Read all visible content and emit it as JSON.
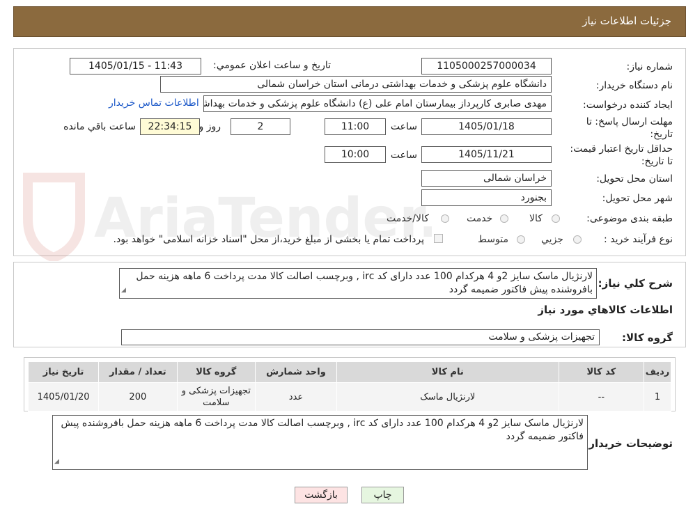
{
  "header": {
    "title": "جزئیات اطلاعات نیاز"
  },
  "watermark_text": "AriaTender.neT",
  "form": {
    "need_number_label": "شماره نیاز:",
    "need_number": "1105000257000034",
    "announce_label": "تاریخ و ساعت اعلان عمومي:",
    "announce_value": "1405/01/15 - 11:43",
    "buyer_org_label": "نام دستگاه خريدار:",
    "buyer_org": "دانشگاه علوم پزشکی و خدمات بهداشتی درمانی استان خراسان شمالی",
    "creator_label": "ايجاد کننده درخواست:",
    "creator": "مهدی صابری کارپرداز بیمارستان امام علی (ع) دانشگاه علوم پزشکی و خدمات بهداشتی درمانی",
    "contact_link": "اطلاعات تماس خريدار",
    "deadline_label": "مهلت ارسال پاسخ: تا تاريخ:",
    "deadline_date": "1405/01/18",
    "time_label": "ساعت",
    "deadline_time": "11:00",
    "days_value": "2",
    "days_label": "روز و",
    "remaining_time": "22:34:15",
    "remaining_label": "ساعت باقي مانده",
    "validity_label": "حداقل تاريخ اعتبار قيمت: تا تاريخ:",
    "validity_date": "1405/11/21",
    "validity_time": "10:00",
    "province_label": "استان محل تحويل:",
    "province": "خراسان شمالی",
    "city_label": "شهر محل تحويل:",
    "city": "بجنورد",
    "category_label": "طبقه بندی موضوعی:",
    "category_options": [
      "کالا",
      "خدمت",
      "کالا/خدمت"
    ],
    "process_label": "نوع فرآيند خريد :",
    "process_options": [
      "جزيي",
      "متوسط"
    ],
    "payment_note": "پرداخت تمام یا بخشی از مبلغ خرید،از محل \"اسناد خزانه اسلامی\" خواهد بود."
  },
  "summary": {
    "label": "شرح کلي نياز:",
    "text": "لارنژیال ماسک سایز 2و 4 هرکدام 100 عدد دارای کد irc , وبرچسب اصالت کالا مدت پرداخت 6 ماهه هزینه حمل بافروشنده پیش فاکتور ضمیمه گردد"
  },
  "goods_section_title": "اطلاعات کالاهاي مورد نياز",
  "goods_group": {
    "label": "گروه کالا:",
    "value": "تجهیزات پزشکی و سلامت"
  },
  "table": {
    "headers": [
      "رديف",
      "کد کالا",
      "نام کالا",
      "واحد شمارش",
      "گروه کالا",
      "تعداد / مقدار",
      "تاريخ نياز"
    ],
    "rows": [
      [
        "1",
        "--",
        "لارنژیال ماسک",
        "عدد",
        "تجهیزات پزشکی و سلامت",
        "200",
        "1405/01/20"
      ]
    ]
  },
  "buyer_notes": {
    "label": "توضيحات خريدار:",
    "text": "لارنژیال ماسک سایز 2و 4 هرکدام 100 عدد دارای کد irc , وبرچسب اصالت کالا مدت پرداخت 6 ماهه هزینه حمل بافروشنده پیش فاکتور ضمیمه گردد"
  },
  "buttons": {
    "print": "چاپ",
    "back": "بازگشت"
  },
  "colors": {
    "header_bg": "#8b6a3e",
    "link": "#1a57c8",
    "back_button_bg": "#fde3e3",
    "print_button_bg": "#e6f6e0",
    "time_box_bg": "#fffbd6"
  }
}
